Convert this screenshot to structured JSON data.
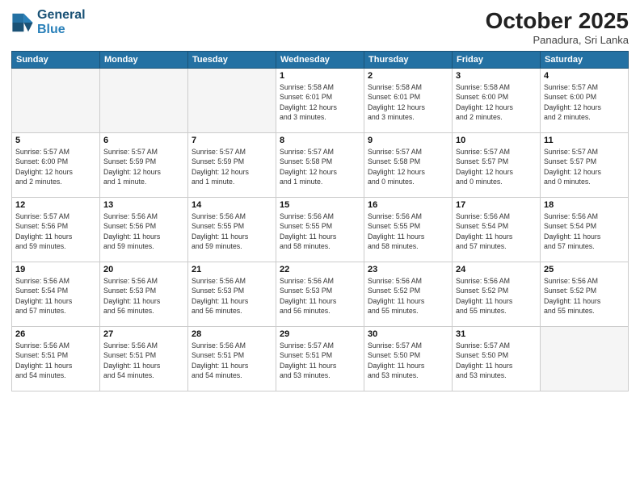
{
  "logo": {
    "line1": "General",
    "line2": "Blue"
  },
  "title": "October 2025",
  "subtitle": "Panadura, Sri Lanka",
  "weekdays": [
    "Sunday",
    "Monday",
    "Tuesday",
    "Wednesday",
    "Thursday",
    "Friday",
    "Saturday"
  ],
  "weeks": [
    [
      {
        "day": "",
        "info": ""
      },
      {
        "day": "",
        "info": ""
      },
      {
        "day": "",
        "info": ""
      },
      {
        "day": "1",
        "info": "Sunrise: 5:58 AM\nSunset: 6:01 PM\nDaylight: 12 hours\nand 3 minutes."
      },
      {
        "day": "2",
        "info": "Sunrise: 5:58 AM\nSunset: 6:01 PM\nDaylight: 12 hours\nand 3 minutes."
      },
      {
        "day": "3",
        "info": "Sunrise: 5:58 AM\nSunset: 6:00 PM\nDaylight: 12 hours\nand 2 minutes."
      },
      {
        "day": "4",
        "info": "Sunrise: 5:57 AM\nSunset: 6:00 PM\nDaylight: 12 hours\nand 2 minutes."
      }
    ],
    [
      {
        "day": "5",
        "info": "Sunrise: 5:57 AM\nSunset: 6:00 PM\nDaylight: 12 hours\nand 2 minutes."
      },
      {
        "day": "6",
        "info": "Sunrise: 5:57 AM\nSunset: 5:59 PM\nDaylight: 12 hours\nand 1 minute."
      },
      {
        "day": "7",
        "info": "Sunrise: 5:57 AM\nSunset: 5:59 PM\nDaylight: 12 hours\nand 1 minute."
      },
      {
        "day": "8",
        "info": "Sunrise: 5:57 AM\nSunset: 5:58 PM\nDaylight: 12 hours\nand 1 minute."
      },
      {
        "day": "9",
        "info": "Sunrise: 5:57 AM\nSunset: 5:58 PM\nDaylight: 12 hours\nand 0 minutes."
      },
      {
        "day": "10",
        "info": "Sunrise: 5:57 AM\nSunset: 5:57 PM\nDaylight: 12 hours\nand 0 minutes."
      },
      {
        "day": "11",
        "info": "Sunrise: 5:57 AM\nSunset: 5:57 PM\nDaylight: 12 hours\nand 0 minutes."
      }
    ],
    [
      {
        "day": "12",
        "info": "Sunrise: 5:57 AM\nSunset: 5:56 PM\nDaylight: 11 hours\nand 59 minutes."
      },
      {
        "day": "13",
        "info": "Sunrise: 5:56 AM\nSunset: 5:56 PM\nDaylight: 11 hours\nand 59 minutes."
      },
      {
        "day": "14",
        "info": "Sunrise: 5:56 AM\nSunset: 5:55 PM\nDaylight: 11 hours\nand 59 minutes."
      },
      {
        "day": "15",
        "info": "Sunrise: 5:56 AM\nSunset: 5:55 PM\nDaylight: 11 hours\nand 58 minutes."
      },
      {
        "day": "16",
        "info": "Sunrise: 5:56 AM\nSunset: 5:55 PM\nDaylight: 11 hours\nand 58 minutes."
      },
      {
        "day": "17",
        "info": "Sunrise: 5:56 AM\nSunset: 5:54 PM\nDaylight: 11 hours\nand 57 minutes."
      },
      {
        "day": "18",
        "info": "Sunrise: 5:56 AM\nSunset: 5:54 PM\nDaylight: 11 hours\nand 57 minutes."
      }
    ],
    [
      {
        "day": "19",
        "info": "Sunrise: 5:56 AM\nSunset: 5:54 PM\nDaylight: 11 hours\nand 57 minutes."
      },
      {
        "day": "20",
        "info": "Sunrise: 5:56 AM\nSunset: 5:53 PM\nDaylight: 11 hours\nand 56 minutes."
      },
      {
        "day": "21",
        "info": "Sunrise: 5:56 AM\nSunset: 5:53 PM\nDaylight: 11 hours\nand 56 minutes."
      },
      {
        "day": "22",
        "info": "Sunrise: 5:56 AM\nSunset: 5:53 PM\nDaylight: 11 hours\nand 56 minutes."
      },
      {
        "day": "23",
        "info": "Sunrise: 5:56 AM\nSunset: 5:52 PM\nDaylight: 11 hours\nand 55 minutes."
      },
      {
        "day": "24",
        "info": "Sunrise: 5:56 AM\nSunset: 5:52 PM\nDaylight: 11 hours\nand 55 minutes."
      },
      {
        "day": "25",
        "info": "Sunrise: 5:56 AM\nSunset: 5:52 PM\nDaylight: 11 hours\nand 55 minutes."
      }
    ],
    [
      {
        "day": "26",
        "info": "Sunrise: 5:56 AM\nSunset: 5:51 PM\nDaylight: 11 hours\nand 54 minutes."
      },
      {
        "day": "27",
        "info": "Sunrise: 5:56 AM\nSunset: 5:51 PM\nDaylight: 11 hours\nand 54 minutes."
      },
      {
        "day": "28",
        "info": "Sunrise: 5:56 AM\nSunset: 5:51 PM\nDaylight: 11 hours\nand 54 minutes."
      },
      {
        "day": "29",
        "info": "Sunrise: 5:57 AM\nSunset: 5:51 PM\nDaylight: 11 hours\nand 53 minutes."
      },
      {
        "day": "30",
        "info": "Sunrise: 5:57 AM\nSunset: 5:50 PM\nDaylight: 11 hours\nand 53 minutes."
      },
      {
        "day": "31",
        "info": "Sunrise: 5:57 AM\nSunset: 5:50 PM\nDaylight: 11 hours\nand 53 minutes."
      },
      {
        "day": "",
        "info": ""
      }
    ]
  ]
}
